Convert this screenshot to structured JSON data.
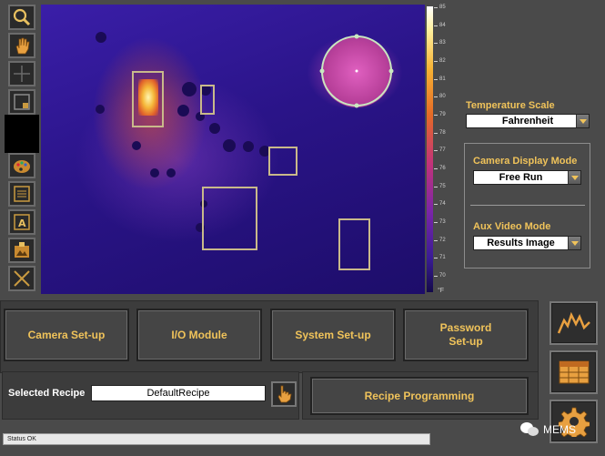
{
  "toolbar": {
    "tools": [
      {
        "icon": "zoom-icon"
      },
      {
        "icon": "pan-hand-icon"
      },
      {
        "icon": "crosshair-icon"
      },
      {
        "icon": "region-select-icon"
      },
      {
        "icon": "palette-icon"
      },
      {
        "icon": "list-icon"
      },
      {
        "icon": "text-label-icon"
      },
      {
        "icon": "image-export-icon"
      },
      {
        "icon": "clear-icon"
      }
    ]
  },
  "color_scale": {
    "ticks": [
      "85",
      "84",
      "83",
      "82",
      "81",
      "80",
      "79",
      "78",
      "77",
      "76",
      "75",
      "74",
      "73",
      "72",
      "71",
      "70"
    ],
    "unit": "°F",
    "colors": [
      "#ffffff",
      "#f7b233",
      "#e56a26",
      "#c2337a",
      "#7a25a8",
      "#140a4a"
    ]
  },
  "settings": {
    "temperature_scale": {
      "label": "Temperature Scale",
      "value": "Fahrenheit"
    },
    "camera_display_mode": {
      "label": "Camera Display Mode",
      "value": "Free Run"
    },
    "aux_video_mode": {
      "label": "Aux Video Mode",
      "value": "Results Image"
    }
  },
  "buttons": {
    "camera_setup": "Camera Set-up",
    "io_module": "I/O Module",
    "system_setup": "System Set-up",
    "password_setup_line1": "Password",
    "password_setup_line2": "Set-up",
    "recipe_programming": "Recipe Programming"
  },
  "recipe": {
    "label": "Selected Recipe",
    "value": "DefaultRecipe"
  },
  "side_buttons": [
    {
      "icon": "chart-peaks-icon"
    },
    {
      "icon": "table-grid-icon"
    },
    {
      "icon": "gear-icon"
    }
  ],
  "status": {
    "text": "Status OK"
  },
  "watermark": {
    "text": "MEMS"
  },
  "accent_color": "#f0c35a"
}
